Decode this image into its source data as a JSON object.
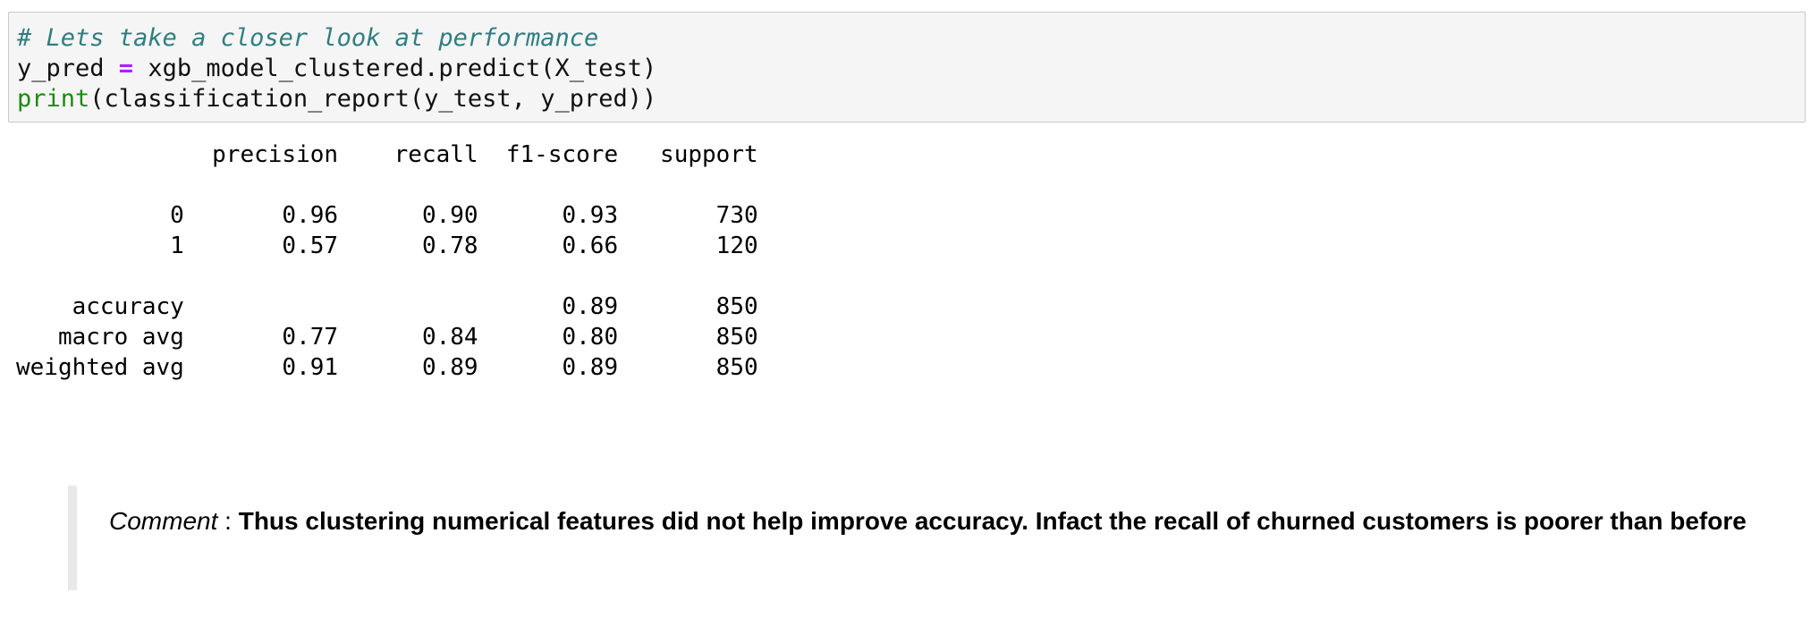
{
  "code": {
    "comment": "# Lets take a closer look at performance",
    "line2_var": "y_pred ",
    "line2_op": "=",
    "line2_rest": " xgb_model_clustered.predict(X_test)",
    "line3_builtin": "print",
    "line3_rest": "(classification_report(y_test, y_pred))"
  },
  "output": {
    "lines": [
      "              precision    recall  f1-score   support",
      "",
      "           0       0.96      0.90      0.93       730",
      "           1       0.57      0.78      0.66       120",
      "",
      "    accuracy                           0.89       850",
      "   macro avg       0.77      0.84      0.80       850",
      "weighted avg       0.91      0.89      0.89       850"
    ]
  },
  "markdown": {
    "label": "Comment",
    "separator": " : ",
    "text": "Thus clustering numerical features did not help improve accuracy. Infact the recall of churned customers is poorer than before"
  }
}
